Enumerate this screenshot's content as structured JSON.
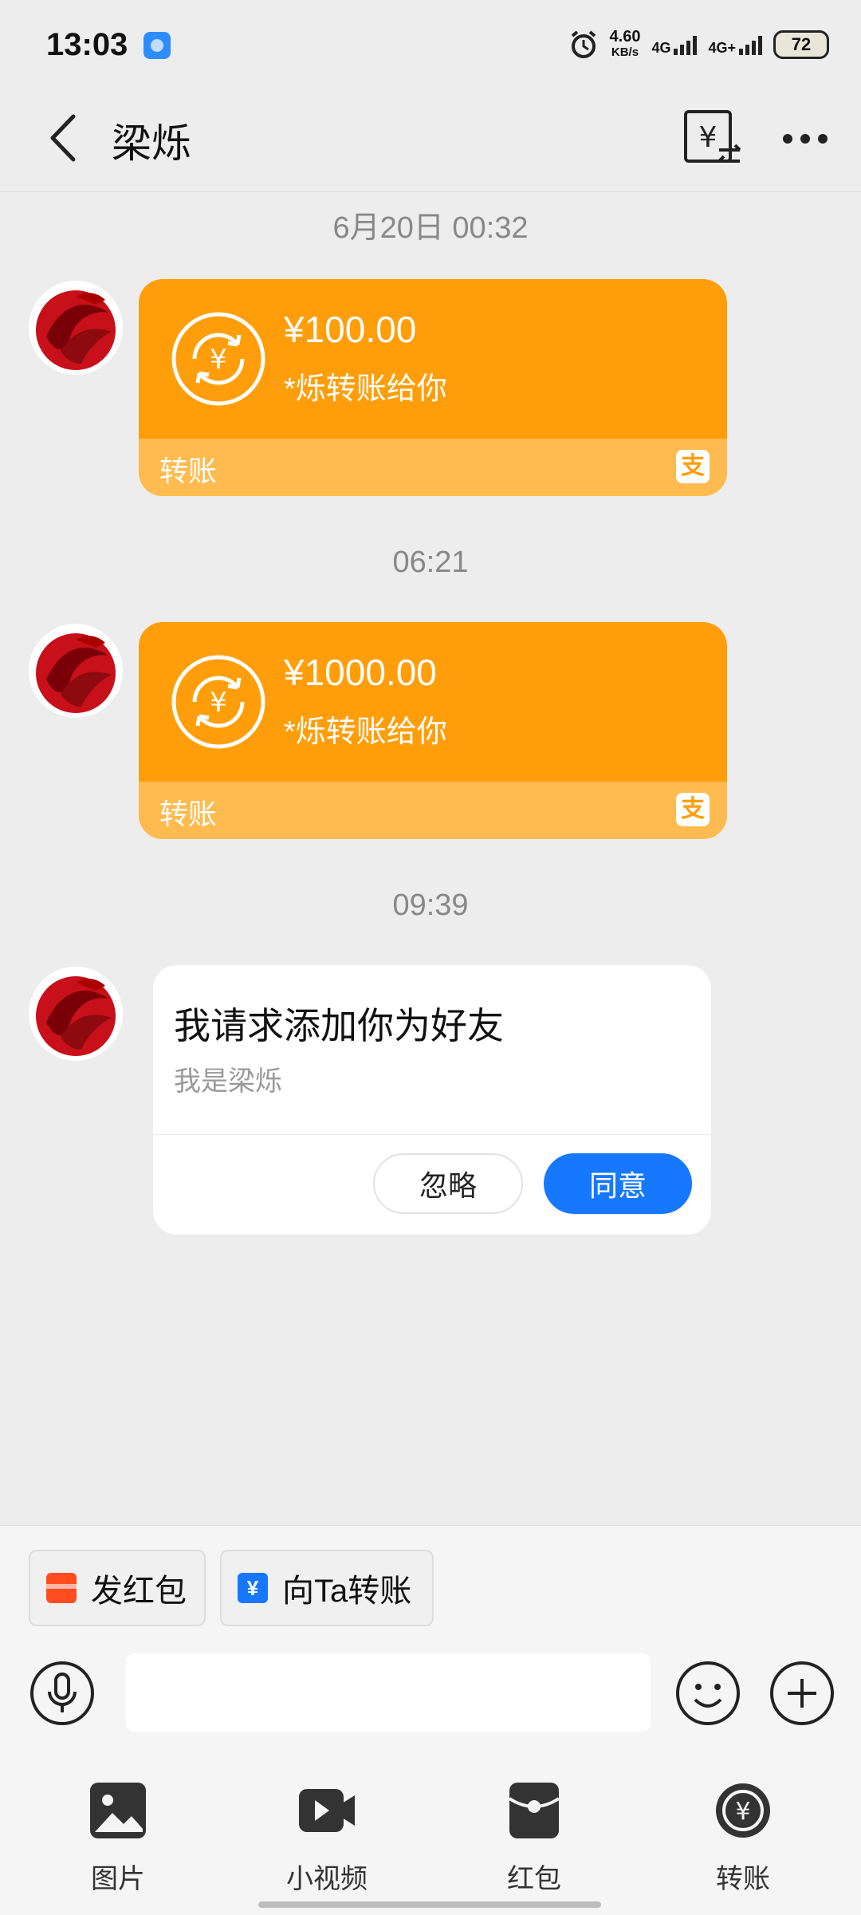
{
  "status_bar": {
    "time": "13:03",
    "net_speed_value": "4.60",
    "net_speed_unit": "KB/s",
    "sim1_type": "4G",
    "sim2_type": "4G+",
    "battery": "72",
    "icons": [
      "app-notification-icon",
      "alarm-icon",
      "signal-icon",
      "battery-icon"
    ]
  },
  "header": {
    "title": "梁烁",
    "icons": [
      "back-icon",
      "transfer-record-icon",
      "more-icon"
    ]
  },
  "messages": [
    {
      "timestamp": "6月20日 00:32",
      "type": "transfer",
      "amount": "¥100.00",
      "note": "*烁转账给你",
      "footer": "转账",
      "brand_icon": "支"
    },
    {
      "timestamp": "06:21",
      "type": "transfer",
      "amount": "¥1000.00",
      "note": "*烁转账给你",
      "footer": "转账",
      "brand_icon": "支"
    },
    {
      "timestamp": "09:39",
      "type": "friend_request",
      "title": "我请求添加你为好友",
      "subtitle": "我是梁烁",
      "ignore_label": "忽略",
      "agree_label": "同意"
    }
  ],
  "quick_actions": [
    {
      "label": "发红包",
      "icon": "red-packet-icon"
    },
    {
      "label": "向Ta转账",
      "icon": "yuan-transfer-icon"
    }
  ],
  "input_bar": {
    "value": "",
    "icons": [
      "voice-icon",
      "emoji-icon",
      "plus-icon"
    ]
  },
  "toolbar": [
    {
      "label": "图片",
      "icon": "image-icon"
    },
    {
      "label": "小视频",
      "icon": "video-icon"
    },
    {
      "label": "红包",
      "icon": "red-envelope-icon"
    },
    {
      "label": "转账",
      "icon": "transfer-icon"
    }
  ],
  "colors": {
    "transfer_bubble": "#ff9e0a",
    "transfer_footer": "#ffbb4f",
    "agree_button": "#1677ff",
    "background": "#ededed"
  }
}
